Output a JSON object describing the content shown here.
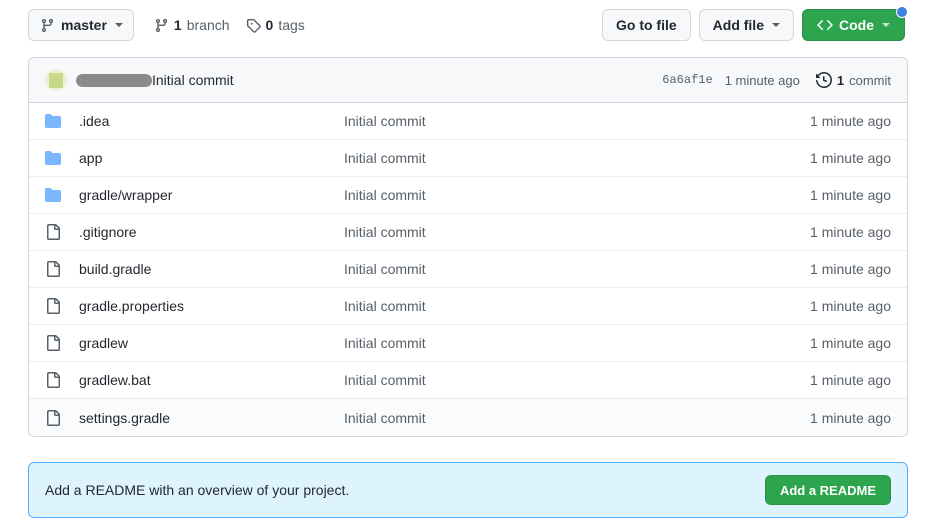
{
  "toolbar": {
    "branch_selector": {
      "label": "master",
      "icon": "git-branch-icon",
      "caret": "chevron-down-icon"
    },
    "branch_count": {
      "count": "1",
      "label": "branch",
      "icon": "git-branch-icon"
    },
    "tag_count": {
      "count": "0",
      "label": "tags",
      "icon": "tag-icon"
    },
    "go_to_file_label": "Go to file",
    "add_file_label": "Add file",
    "code_label": "Code",
    "code_icon": "code-brackets-icon",
    "notification_dot": true
  },
  "commit_header": {
    "avatar": "user-avatar",
    "author_redacted": true,
    "message": "Initial commit",
    "sha": "6a6af1e",
    "relative_time": "1 minute ago",
    "commit_count": "1",
    "commit_count_label": "commit",
    "history_icon": "history-clock-icon"
  },
  "file_list": {
    "columns": [
      "name",
      "last_commit_message",
      "last_commit_time"
    ],
    "rows": [
      {
        "type": "folder",
        "icon": "folder-icon",
        "name": ".idea",
        "message": "Initial commit",
        "time": "1 minute ago"
      },
      {
        "type": "folder",
        "icon": "folder-icon",
        "name": "app",
        "message": "Initial commit",
        "time": "1 minute ago"
      },
      {
        "type": "folder",
        "icon": "folder-icon",
        "name": "gradle/wrapper",
        "message": "Initial commit",
        "time": "1 minute ago"
      },
      {
        "type": "file",
        "icon": "file-icon",
        "name": ".gitignore",
        "message": "Initial commit",
        "time": "1 minute ago"
      },
      {
        "type": "file",
        "icon": "file-icon",
        "name": "build.gradle",
        "message": "Initial commit",
        "time": "1 minute ago"
      },
      {
        "type": "file",
        "icon": "file-icon",
        "name": "gradle.properties",
        "message": "Initial commit",
        "time": "1 minute ago"
      },
      {
        "type": "file",
        "icon": "file-icon",
        "name": "gradlew",
        "message": "Initial commit",
        "time": "1 minute ago"
      },
      {
        "type": "file",
        "icon": "file-icon",
        "name": "gradlew.bat",
        "message": "Initial commit",
        "time": "1 minute ago"
      },
      {
        "type": "file",
        "icon": "file-icon",
        "name": "settings.gradle",
        "message": "Initial commit",
        "time": "1 minute ago"
      }
    ]
  },
  "readme_banner": {
    "text": "Add a README with an overview of your project.",
    "button_label": "Add a README"
  },
  "colors": {
    "green_button": "#2da44e",
    "banner_background": "#ddf4ff",
    "banner_border": "#54aeff",
    "folder_icon": "#79b8ff",
    "notification_dot": "#3f7fe0",
    "header_background": "#f6f8fa",
    "border": "#d0d7de",
    "muted_text": "#57606a"
  }
}
